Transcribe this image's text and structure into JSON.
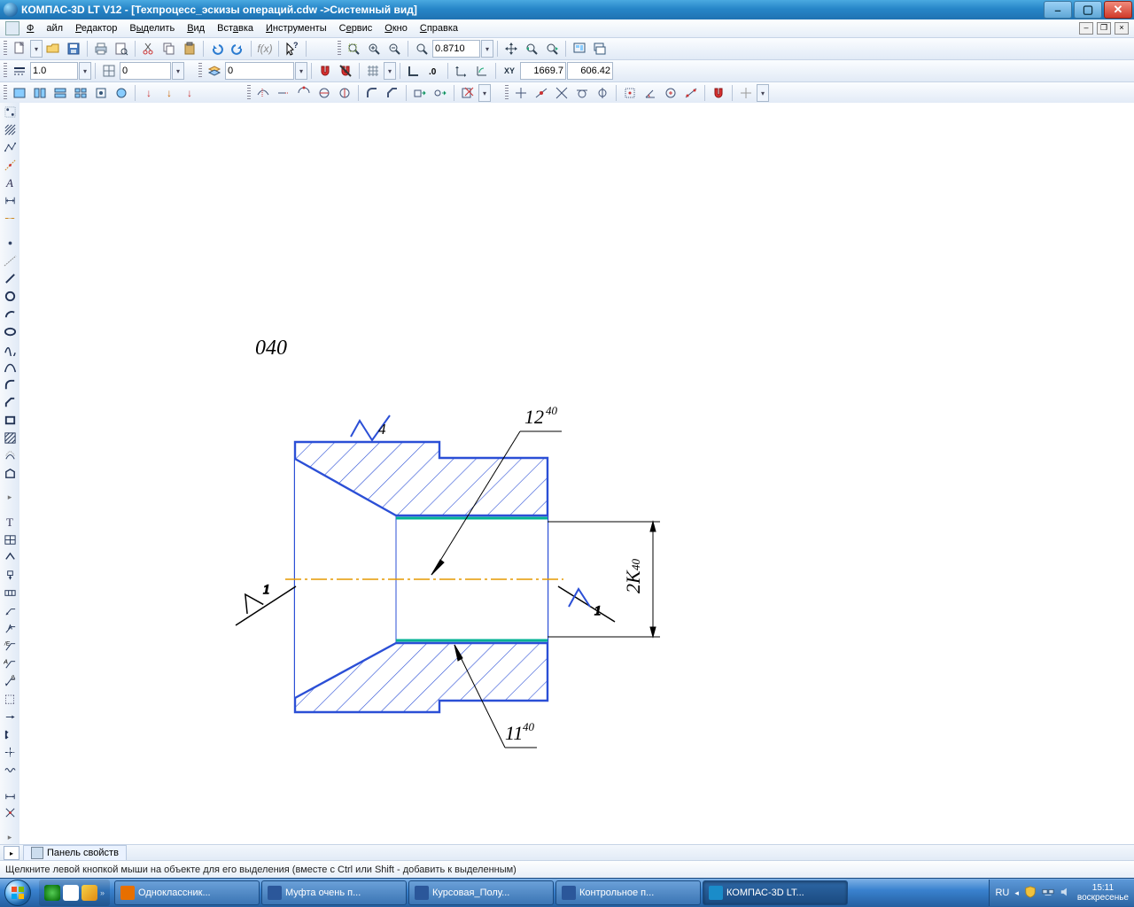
{
  "title": "КОМПАС-3D LT V12 - [Техпроцесс_эскизы операций.cdw ->Системный вид]",
  "menu": {
    "file": "Файл",
    "edit": "Редактор",
    "select": "Выделить",
    "view": "Вид",
    "insert": "Вставка",
    "tools": "Инструменты",
    "service": "Сервис",
    "window": "Окно",
    "help": "Справка"
  },
  "toolbar1": {
    "zoom": "0.8710"
  },
  "toolbar2": {
    "scale": "1.0",
    "step": "0",
    "layer": "0",
    "coordX": "1669.7",
    "coordY": "606.42"
  },
  "panel": {
    "label": "Панель свойств"
  },
  "status": "Щелкните левой кнопкой мыши на объекте для его выделения (вместе с Ctrl или Shift - добавить к выделенным)",
  "drawing": {
    "op": "040",
    "dim_top": "12",
    "dim_top_sup": "40",
    "dim_bot": "11",
    "dim_bot_sup": "40",
    "dim_right": "2K",
    "dim_right_sup": "40",
    "rough": "4"
  },
  "taskbar": {
    "items": [
      {
        "label": "Одноклассник...",
        "icon": "#e76f00"
      },
      {
        "label": "Муфта очень п...",
        "icon": "#2b579a"
      },
      {
        "label": "Курсовая_Полу...",
        "icon": "#2b579a"
      },
      {
        "label": "Контрольное п...",
        "icon": "#2b579a"
      },
      {
        "label": "КОМПАС-3D LT...",
        "icon": "#1a8cc9",
        "active": true
      }
    ],
    "lang": "RU",
    "time": "15:11",
    "day": "воскресенье"
  }
}
